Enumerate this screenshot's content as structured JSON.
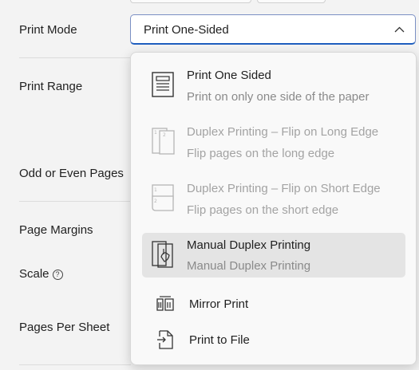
{
  "settings": {
    "print_mode_label": "Print Mode",
    "print_range_label": "Print Range",
    "odd_even_label": "Odd or Even Pages",
    "page_margins_label": "Page Margins",
    "scale_label": "Scale",
    "pages_per_sheet_label": "Pages Per Sheet"
  },
  "print_mode": {
    "selected": "Print One-Sided",
    "options": [
      {
        "title": "Print One Sided",
        "desc": "Print on only one side of the paper",
        "icon": "one-sided-page-icon",
        "state": "normal"
      },
      {
        "title": "Duplex Printing – Flip on Long Edge",
        "desc": "Flip pages on the long edge",
        "icon": "flip-long-edge-icon",
        "state": "disabled"
      },
      {
        "title": "Duplex Printing – Flip on Short Edge",
        "desc": "Flip pages on the short edge",
        "icon": "flip-short-edge-icon",
        "state": "disabled"
      },
      {
        "title": "Manual Duplex Printing",
        "desc": "Manual Duplex Printing",
        "icon": "manual-duplex-icon",
        "state": "highlighted"
      },
      {
        "title": "Mirror Print",
        "icon": "mirror-print-icon",
        "state": "normal"
      },
      {
        "title": "Print to File",
        "icon": "print-to-file-icon",
        "state": "normal"
      }
    ]
  },
  "colors": {
    "accent": "#1f5fbf",
    "disabled_text": "#a3a3a3",
    "highlight": "#e4e4e4"
  }
}
